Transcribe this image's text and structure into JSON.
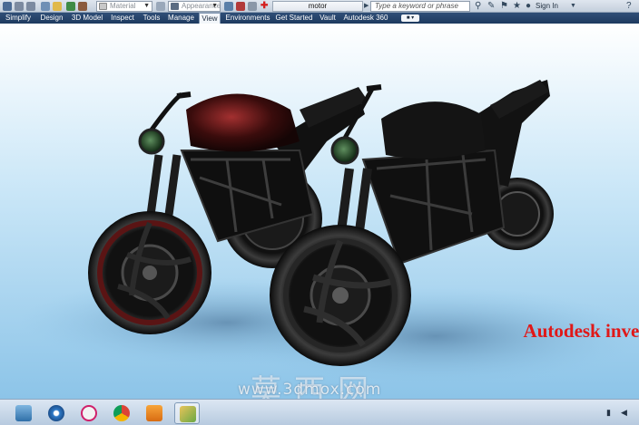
{
  "quick_access": {
    "material_value": "Material",
    "appearance_value": "Appearance",
    "document_title": "motor",
    "search_placeholder": "Type a keyword or phrase",
    "sign_in_label": "Sign In",
    "help_label": "?"
  },
  "ribbon": {
    "tabs": [
      {
        "label": "Simplify"
      },
      {
        "label": "Design"
      },
      {
        "label": "3D Model"
      },
      {
        "label": "Inspect"
      },
      {
        "label": "Tools"
      },
      {
        "label": "Manage"
      },
      {
        "label": "View"
      },
      {
        "label": "Environments"
      },
      {
        "label": "Get Started"
      },
      {
        "label": "Vault"
      },
      {
        "label": "Autodesk 360"
      }
    ],
    "active_tab": "View"
  },
  "viewport": {
    "overlay_text": "Autodesk inven",
    "watermark_cn": "莫西网",
    "watermark_url": "www.3dmox.com"
  },
  "taskbar": {
    "apps": [
      {
        "icon": "file-explorer-icon"
      },
      {
        "icon": "media-player-icon"
      },
      {
        "icon": "screen-capture-icon"
      },
      {
        "icon": "chrome-icon"
      },
      {
        "icon": "autodesk-inventor-icon"
      },
      {
        "icon": "folder-app-icon"
      }
    ]
  },
  "colors": {
    "overlay_text": "#e01818",
    "ribbon": "#1e3a5f"
  }
}
